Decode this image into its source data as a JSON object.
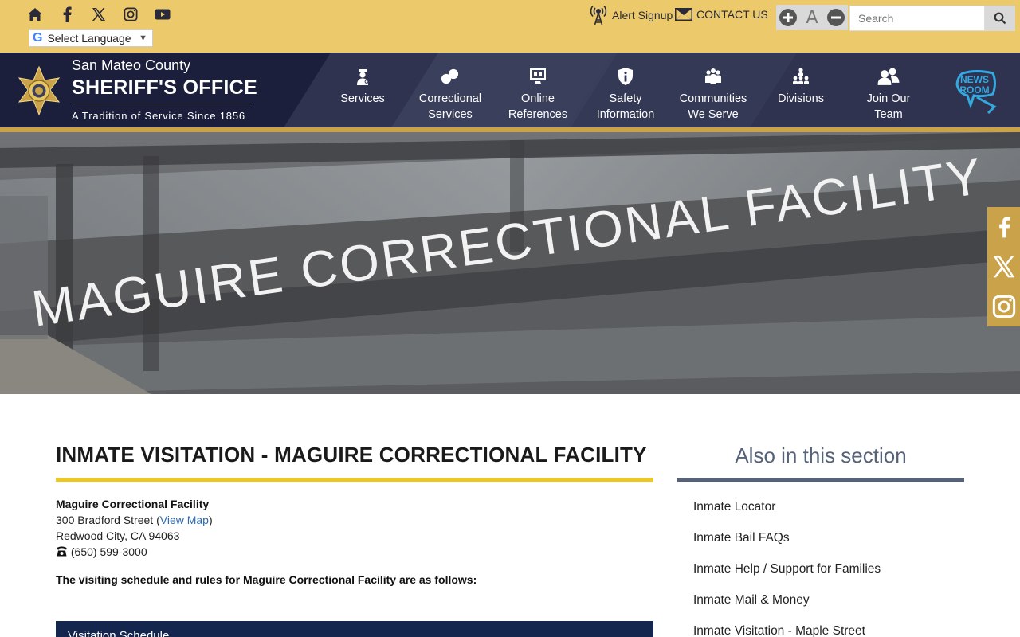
{
  "topbar": {
    "translate_label": "Select Language",
    "google_letter": "G",
    "translate_caret": "▼",
    "alert_label": "Alert Signup",
    "contact_label": "CONTACT US",
    "font_reset_label": "A",
    "search_placeholder": "Search"
  },
  "brand": {
    "county": "San Mateo County",
    "office": "SHERIFF'S OFFICE",
    "tagline": "A Tradition of Service Since 1856"
  },
  "nav": {
    "items": [
      {
        "line1": "Services",
        "line2": ""
      },
      {
        "line1": "Correctional",
        "line2": "Services"
      },
      {
        "line1": "Online",
        "line2": "References"
      },
      {
        "line1": "Safety",
        "line2": "Information"
      },
      {
        "line1": "Communities",
        "line2": "We Serve"
      },
      {
        "line1": "Divisions",
        "line2": ""
      },
      {
        "line1": "Join Our",
        "line2": "Team"
      }
    ],
    "news_line1": "NEWS",
    "news_line2": "ROOM"
  },
  "hero": {
    "sign_text": "MAGUIRE CORRECTIONAL FACILITY"
  },
  "content": {
    "title": "INMATE VISITATION - MAGUIRE CORRECTIONAL FACILITY",
    "facility_name": "Maguire Correctional Facility",
    "street": "300 Bradford Street (",
    "map_link": "View Map",
    "street_close": ")",
    "city": "Redwood City, CA 94063",
    "phone": "(650) 599-3000",
    "intro": "The visiting schedule and rules for Maguire Correctional Facility are as follows:",
    "schedule_header": "Visitation Schedule"
  },
  "sidebar": {
    "title": "Also in this section",
    "items": [
      "Inmate Locator",
      "Inmate Bail FAQs",
      "Inmate Help / Support for Families",
      "Inmate Mail & Money",
      "Inmate Visitation - Maple Street"
    ]
  },
  "colors": {
    "topbar": "#ecc96a",
    "navbar": "#2f3350",
    "gold_rule": "#c9a24a",
    "title_rule": "#efc81f",
    "sidebar_rule": "#56627a",
    "schedule_header": "#14264e",
    "link": "#2a6bb5"
  }
}
